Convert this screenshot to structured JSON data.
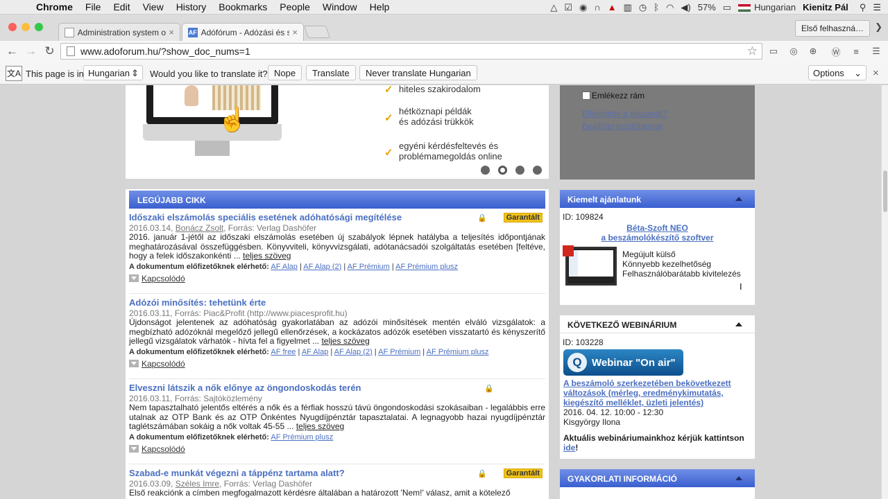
{
  "menubar": {
    "app": "Chrome",
    "items": [
      "File",
      "Edit",
      "View",
      "History",
      "Bookmarks",
      "People",
      "Window",
      "Help"
    ],
    "battery": "57%",
    "language": "Hungarian",
    "user": "Kienitz Pál"
  },
  "tabs": [
    {
      "title": "Administration system of V",
      "active": false
    },
    {
      "title": "Adófórum - Adózási és szá",
      "active": true
    }
  ],
  "profile_button": "Első felhaszná…",
  "address": "www.adoforum.hu/?show_doc_nums=1",
  "translate": {
    "prefix": "This page is in",
    "language": "Hungarian",
    "question": "Would you like to translate it?",
    "nope": "Nope",
    "translate": "Translate",
    "never": "Never translate Hungarian",
    "options": "Options"
  },
  "banner": {
    "features": [
      "hiteles szakirodalom",
      "hétköznapi példák\nés adózási trükkök",
      "egyéni kérdésfeltevés és\nproblémamegoldás online"
    ]
  },
  "login": {
    "remember": "Emlékezz rám",
    "forgot": "Elfelejtette a jelszavát?",
    "homepage": "Beállítás kezdőlapnak"
  },
  "articles_section": "LEGÚJABB CIKK",
  "articles": [
    {
      "title": "Időszaki elszámolás speciális esetének adóhatósági megítélése",
      "date": "2016.03.14,",
      "author": "Bonácz Zsolt",
      "source": ", Forrás: Verlag Dashöfer",
      "badge": "Garantált",
      "body": "2016. január 1-jétől az időszaki elszámolás esetében új szabályok lépnek hatályba a teljesítés időpontjának meghatározásával összefüggésben. Könyvviteli, könyvvizsgálati, adótanácsadói szolgáltatás esetében [feltéve, hogy a felek időszakonkénti ... ",
      "more": "teljes szöveg",
      "avail_label": "A dokumentum előfizetőknek elérhető:",
      "links": [
        "AF Alap",
        "AF Alap (2)",
        "AF Prémium",
        "AF Prémium plusz"
      ],
      "related": "Kapcsolódó"
    },
    {
      "title": "Adózói minősítés: tehetünk érte",
      "date": "2016.03.11,",
      "author": "",
      "source": " Forrás: Piac&Profit (http://www.piacesprofit.hu)",
      "badge": "",
      "body": "Újdonságot jelentenek az adóhatóság gyakorlatában az adózói minősítések mentén elváló vizsgálatok: a megbízható adózóknál megelőző jellegű ellenőrzések, a kockázatos adózók esetében visszatartó és kényszerítő jellegű vizsgálatok várhatók - hívta fel a figyelmet ... ",
      "more": "teljes szöveg",
      "avail_label": "A dokumentum előfizetőknek elérhető:",
      "links": [
        "AF free",
        "AF Alap",
        "AF Alap (2)",
        "AF Prémium",
        "AF Prémium plusz"
      ],
      "related": "Kapcsolódó"
    },
    {
      "title": "Elveszni látszik a nők előnye az öngondoskodás terén",
      "date": "2016.03.11,",
      "author": "",
      "source": " Forrás: Sajtóközlemény",
      "badge": "",
      "body": "Nem tapasztalható jelentős eltérés a nők és a férfiak hosszú távú öngondoskodási szokásaiban - legalábbis erre utalnak az OTP Bank és az OTP Önkéntes Nyugdíjpénztár tapasztalatai. A legnagyobb hazai nyugdíjpénztár taglétszámában sokáig a nők voltak 45-55 ... ",
      "more": "teljes szöveg",
      "avail_label": "A dokumentum előfizetőknek elérhető:",
      "links": [
        "AF Prémium plusz"
      ],
      "related": "Kapcsolódó"
    },
    {
      "title": "Szabad-e munkát végezni a táppénz tartama alatt?",
      "date": "2016.03.09,",
      "author": "Széles Imre",
      "source": ", Forrás: Verlag Dashöfer",
      "badge": "Garantált",
      "body": "Első reakciónk a címben megfogalmazott kérdésre általában a határozott 'Nem!' válasz, amit a kötelező"
    }
  ],
  "featured": {
    "header": "Kiemelt ajánlatunk",
    "id": "ID: 109824",
    "link1": "Béta-Szoft NEO",
    "link2": "a beszámolókészítő szoftver",
    "lines": [
      "Megújult külső",
      "Könnyebb kezelhetőség",
      "Felhasználóbarátabb kivitelezés"
    ]
  },
  "webinar": {
    "header": "KÖVETKEZŐ WEBINÁRIUM",
    "id": "ID: 103228",
    "button": "Webinar \"On air\"",
    "title": "A beszámoló szerkezetében bekövetkezett változások (mérleg, eredménykimutatás, kiegészítő melléklet, üzleti jelentés)",
    "datetime": "2016. 04. 12. 10:00 - 12:30",
    "presenter": "Kisgyörgy Ilona",
    "note": "Aktuális webináriumainkhoz kérjük kattintson ",
    "note_link": "ide",
    "note_end": "!"
  },
  "practice": {
    "header": "GYAKORLATI INFORMÁCIÓ"
  }
}
